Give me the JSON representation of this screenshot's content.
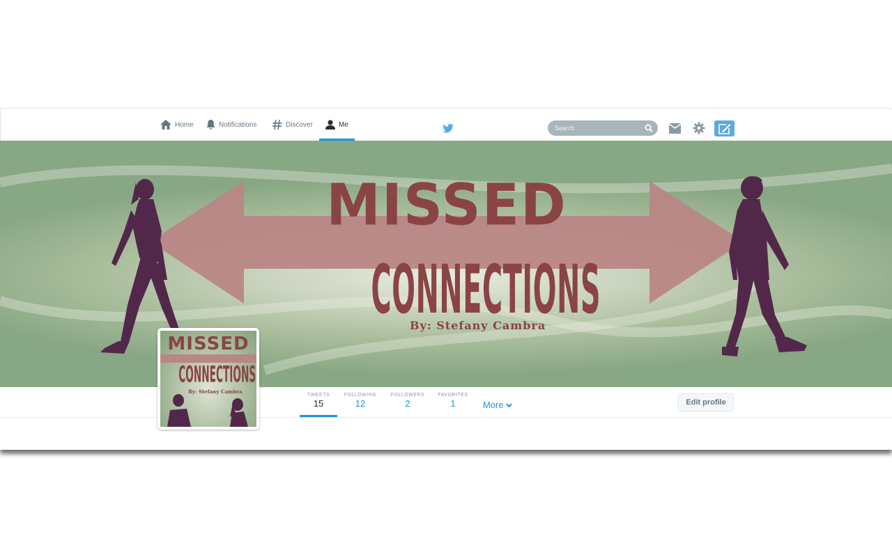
{
  "nav": {
    "home": "Home",
    "notifications": "Notifications",
    "discover": "Discover",
    "me": "Me",
    "search_placeholder": "Search"
  },
  "banner": {
    "title_line1": "MISSED",
    "title_line2": "CONNECTIONS",
    "byline": "By: Stefany Cambra"
  },
  "avatar": {
    "title_line1": "MISSED",
    "title_line2": "CONNECTIONS",
    "byline": "By: Stefany Cambra"
  },
  "profile_nav": {
    "stats": [
      {
        "label": "TWEETS",
        "value": "15"
      },
      {
        "label": "FOLLOWING",
        "value": "12"
      },
      {
        "label": "FOLLOWERS",
        "value": "2"
      },
      {
        "label": "FAVORITES",
        "value": "1"
      }
    ],
    "more": "More",
    "edit_profile": "Edit profile"
  },
  "colors": {
    "accent": "#1b95e0",
    "title": "#8a4446",
    "silhouette": "#52284a",
    "arrow": "#b98686"
  }
}
